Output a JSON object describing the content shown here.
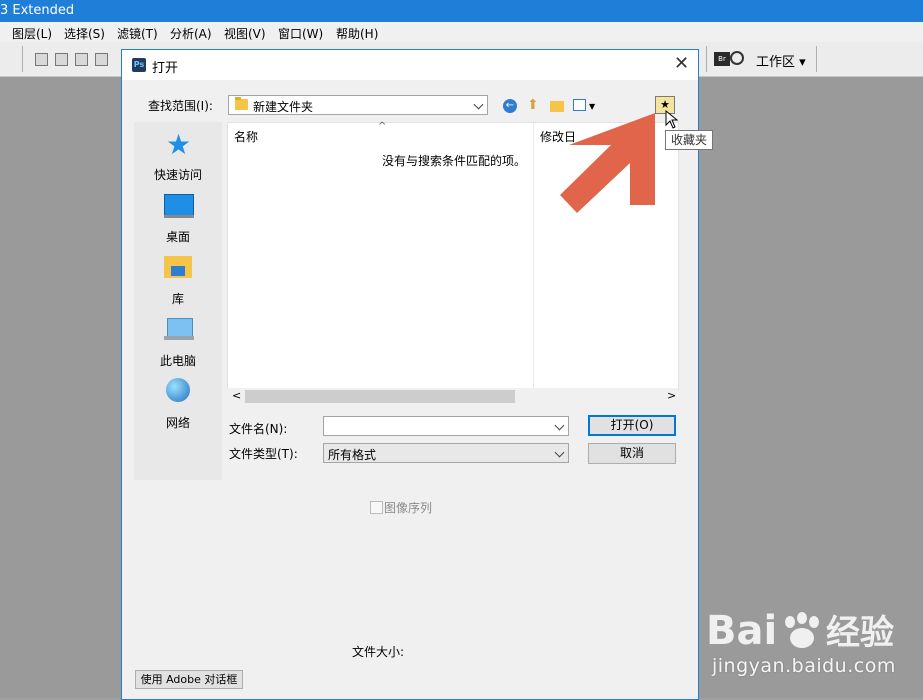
{
  "app": {
    "title": "3 Extended",
    "menu": [
      "图层(L)",
      "选择(S)",
      "滤镜(T)",
      "分析(A)",
      "视图(V)",
      "窗口(W)",
      "帮助(H)"
    ],
    "workspace_label": "工作区"
  },
  "dialog": {
    "title": "打开",
    "look_in_label": "查找范围(I):",
    "look_in_value": "新建文件夹",
    "places": [
      "快速访问",
      "桌面",
      "库",
      "此电脑",
      "网络"
    ],
    "column_name": "名称",
    "column_modified": "修改日",
    "empty_message": "没有与搜索条件匹配的项。",
    "filename_label": "文件名(N):",
    "filename_value": "",
    "filetype_label": "文件类型(T):",
    "filetype_value": "所有格式",
    "open_button": "打开(O)",
    "cancel_button": "取消",
    "image_sequence_label": "图像序列",
    "file_size_label": "文件大小:",
    "adobe_dialog_button": "使用 Adobe 对话框",
    "tooltip": "收藏夹"
  },
  "watermark": {
    "url": "jingyan.baidu.com"
  },
  "colors": {
    "accent": "#1f7fd8",
    "arrow": "#e0654a"
  }
}
